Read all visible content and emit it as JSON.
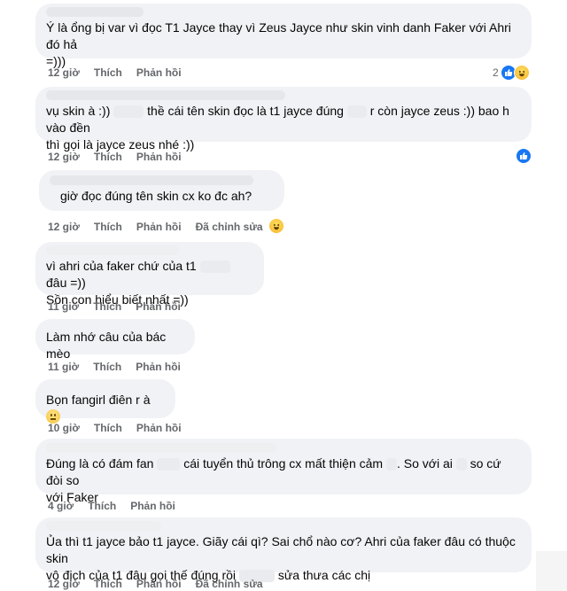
{
  "comments": [
    {
      "text": "Ý là ổng bị var vì đọc T1 Jayce thay vì Zeus Jayce như skin vinh danh Faker với Ahri đó hả\n=)))",
      "time": "12 giờ",
      "like": "Thích",
      "reply": "Phản hồi",
      "reaction_count": "2",
      "reactions": [
        "like-icon",
        "haha-icon"
      ]
    },
    {
      "text_a": "vụ skin à :))",
      "text_b": "thề cái tên skin đọc là t1 jayce đúng",
      "text_c": "r còn jayce zeus :)) bao h vào đền",
      "text_d": "thì gọi là jayce zeus nhé :))",
      "time": "12 giờ",
      "like": "Thích",
      "reply": "Phản hồi",
      "reactions": [
        "like-icon"
      ]
    },
    {
      "text": "giờ đọc đúng tên skin cx ko đc ah?",
      "time": "12 giờ",
      "like": "Thích",
      "reply": "Phản hồi",
      "edit": "Đã chỉnh sửa",
      "reactions": [
        "haha-icon"
      ]
    },
    {
      "text_a": "vì ahri của faker chứ của t1",
      "text_b": "đâu =))",
      "text_c": "Sồn con hiểu biết nhất =))",
      "time": "11 giờ",
      "like": "Thích",
      "reply": "Phản hồi"
    },
    {
      "text": "Làm nhớ câu của bác mèo",
      "time": "11 giờ",
      "like": "Thích",
      "reply": "Phản hồi"
    },
    {
      "text": "Bọn fangirl điên r à",
      "time": "10 giờ",
      "like": "Thích",
      "reply": "Phản hồi",
      "emoji": "neutral-face-icon"
    },
    {
      "text_a": "Đúng là có đám fan",
      "text_b": "cái tuyển thủ trông cx mất thiện cảm",
      "text_c": ". So với ai",
      "text_d": "so cứ đòi so",
      "text_e": "với Faker",
      "time": "4 giờ",
      "like": "Thích",
      "reply": "Phản hồi"
    },
    {
      "text_a": "Ủa thì t1 jayce bảo t1 jayce. Giãy cái qì? Sai chổ nào cơ? Ahri của faker đâu có thuộc skin",
      "text_b": "vô địch của t1 đâu gọi thế đúng rồi",
      "text_c": "sửa thưa các chị",
      "time": "12 giờ",
      "like": "Thích",
      "reply": "Phản hồi",
      "edit": "Đã chỉnh sửa"
    }
  ],
  "colors": {
    "bubble": "#f0f2f5",
    "meta_text": "#65676b",
    "like_blue": "#1877f2",
    "haha_yellow": "#f7b125"
  }
}
